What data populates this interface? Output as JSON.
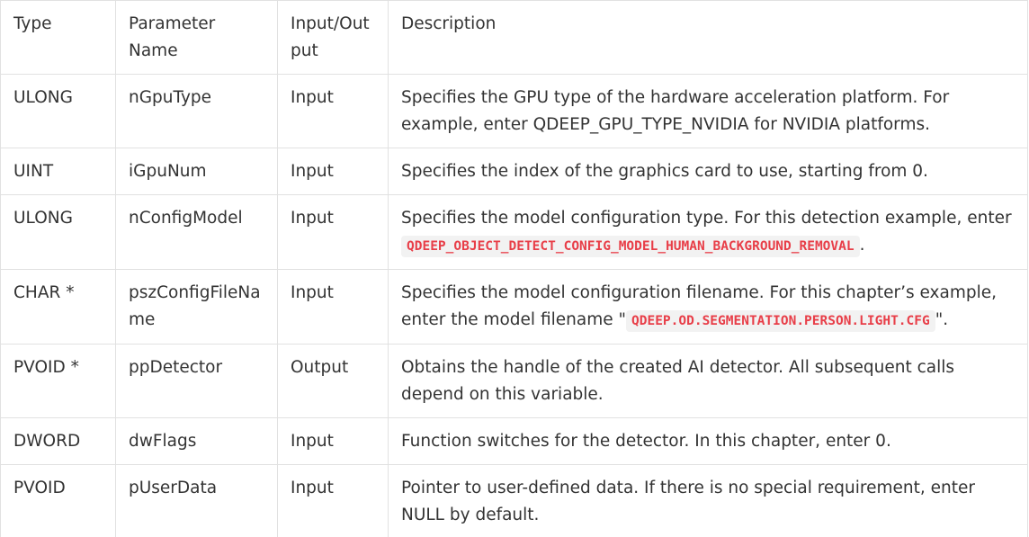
{
  "table": {
    "headers": [
      "Type",
      "Parameter Name",
      "Input/Output",
      "Description"
    ],
    "rows": [
      {
        "type": "ULONG",
        "name": "nGpuType",
        "io": "Input",
        "desc_before": "Specifies the GPU type of the hardware acceleration platform. For example, enter QDEEP_GPU_TYPE_NVIDIA for NVIDIA platforms.",
        "desc_code": "",
        "desc_after": ""
      },
      {
        "type": "UINT",
        "name": "iGpuNum",
        "io": "Input",
        "desc_before": "Specifies the index of the graphics card to use, starting from 0.",
        "desc_code": "",
        "desc_after": ""
      },
      {
        "type": "ULONG",
        "name": "nConfigModel",
        "io": "Input",
        "desc_before": "Specifies the model configuration type. For this detection example, enter ",
        "desc_code": "QDEEP_OBJECT_DETECT_CONFIG_MODEL_HUMAN_BACKGROUND_REMOVAL",
        "desc_after": "."
      },
      {
        "type": "CHAR *",
        "name": "pszConfigFileName",
        "io": "Input",
        "desc_before": "Specifies the model configuration filename. For this chapter’s example, enter the model filename \"",
        "desc_code": "QDEEP.OD.SEGMENTATION.PERSON.LIGHT.CFG",
        "desc_after": "\"."
      },
      {
        "type": "PVOID *",
        "name": "ppDetector",
        "io": "Output",
        "desc_before": "Obtains the handle of the created AI detector. All subsequent calls depend on this variable.",
        "desc_code": "",
        "desc_after": ""
      },
      {
        "type": "DWORD",
        "name": "dwFlags",
        "io": "Input",
        "desc_before": "Function switches for the detector. In this chapter, enter 0.",
        "desc_code": "",
        "desc_after": ""
      },
      {
        "type": "PVOID",
        "name": "pUserData",
        "io": "Input",
        "desc_before": "Pointer to user-defined data. If there is no special requirement, enter NULL by default.",
        "desc_code": "",
        "desc_after": ""
      }
    ]
  }
}
